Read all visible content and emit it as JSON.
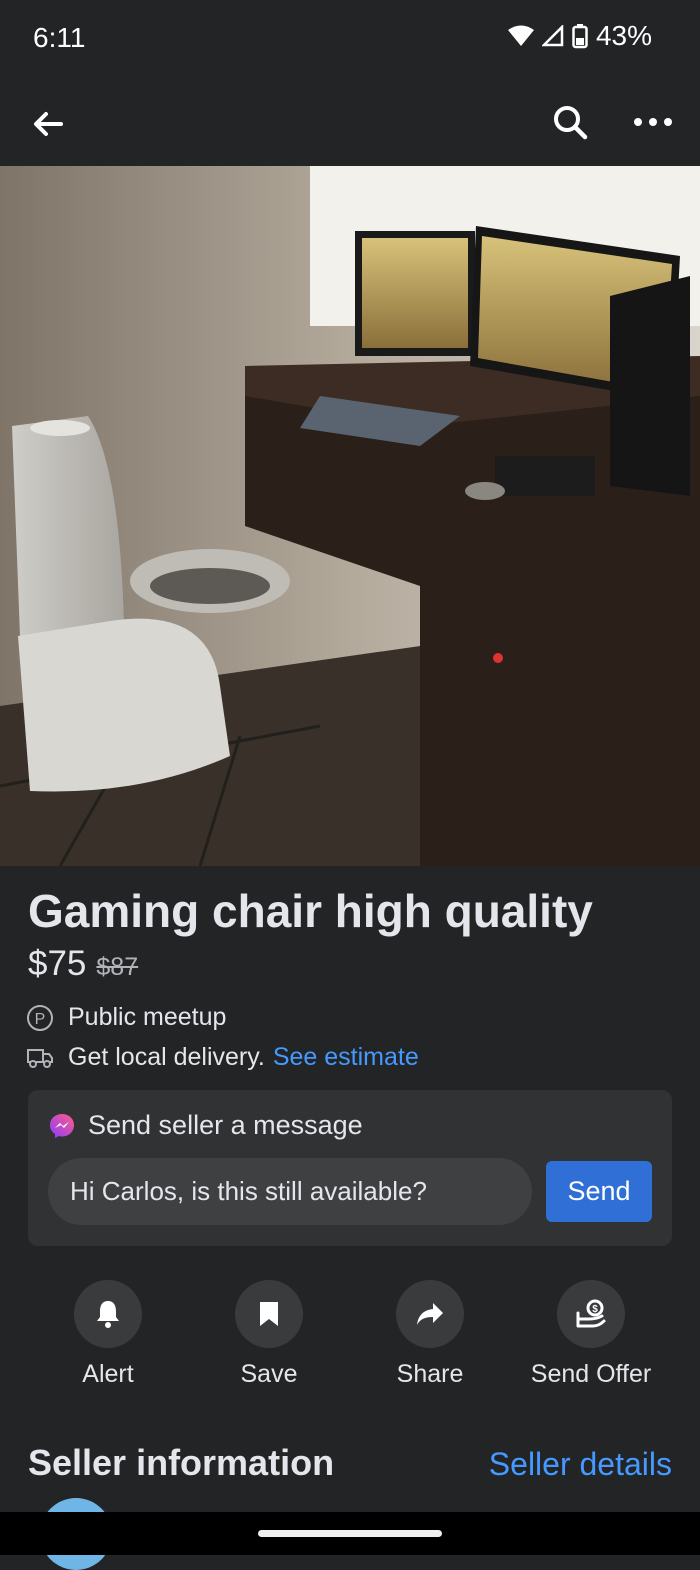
{
  "status": {
    "time": "6:11",
    "battery": "43%"
  },
  "topbar": {
    "back_icon": "arrow-left-icon",
    "search_icon": "search-icon",
    "more_icon": "more-horizontal-icon"
  },
  "listing": {
    "title": "Gaming chair high quality",
    "price": "$75",
    "old_price": "$87",
    "meetup": "Public meetup",
    "delivery": "Get local delivery.",
    "delivery_link": "See estimate"
  },
  "message": {
    "header": "Send seller a message",
    "input_value": "Hi Carlos, is this still available?",
    "send_label": "Send"
  },
  "actions": [
    {
      "label": "Alert",
      "icon": "bell-icon"
    },
    {
      "label": "Save",
      "icon": "bookmark-icon"
    },
    {
      "label": "Share",
      "icon": "share-arrow-icon"
    },
    {
      "label": "Send Offer",
      "icon": "offer-hand-icon"
    }
  ],
  "seller": {
    "title": "Seller information",
    "details_link": "Seller details"
  },
  "colors": {
    "background": "#222425",
    "accent": "#2f6fd6",
    "link": "#4599ff"
  }
}
